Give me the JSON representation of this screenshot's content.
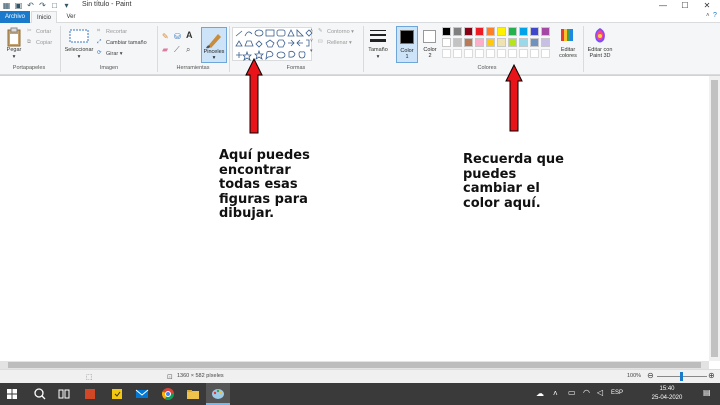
{
  "window": {
    "title": "Sin título - Paint",
    "controls": {
      "minimize": "—",
      "maximize": "☐",
      "close": "✕"
    }
  },
  "tabs": [
    {
      "label": "Archivo"
    },
    {
      "label": "Inicio"
    },
    {
      "label": "Ver"
    }
  ],
  "ribbon": {
    "clipboard": {
      "paste": "Pegar",
      "cut": "Cortar",
      "copy": "Copiar",
      "group": "Portapapeles"
    },
    "image": {
      "select": "Seleccionar",
      "crop": "Recortar",
      "resize": "Cambiar tamaño",
      "rotate": "Girar",
      "group": "Imagen"
    },
    "tools": {
      "brushes": "Pinceles",
      "group": "Herramientas"
    },
    "shapes": {
      "outline": "Contorno",
      "fill": "Rellenar",
      "group": "Formas"
    },
    "size": {
      "label": "Tamaño"
    },
    "color1": {
      "label": "Color",
      "sub": "1"
    },
    "color2": {
      "label": "Color",
      "sub": "2"
    },
    "colors_group": "Colores",
    "edit_colors": {
      "line1": "Editar",
      "line2": "colores"
    },
    "paint3d": {
      "line1": "Editar con",
      "line2": "Paint 3D"
    },
    "palette": [
      "#000000",
      "#7f7f7f",
      "#880015",
      "#ed1c24",
      "#ff7f27",
      "#fff200",
      "#22b14c",
      "#00a2e8",
      "#3f48cc",
      "#a349a4",
      "#ffffff",
      "#c3c3c3",
      "#b97a57",
      "#ffaec9",
      "#ffc90e",
      "#efe4b0",
      "#b5e61d",
      "#99d9ea",
      "#7092be",
      "#c8bfe7"
    ]
  },
  "annotations": {
    "left": [
      "Aquí puedes",
      "encontrar",
      "todas esas",
      "figuras para",
      "dibujar."
    ],
    "right": [
      "Recuerda que",
      "puedes",
      "cambiar el",
      "color aquí."
    ]
  },
  "status": {
    "dimensions": "1360 × 582 píxeles",
    "zoom": "100%"
  },
  "taskbar": {
    "language": "ESP",
    "time": "15:40",
    "date": "25-04-2020"
  }
}
